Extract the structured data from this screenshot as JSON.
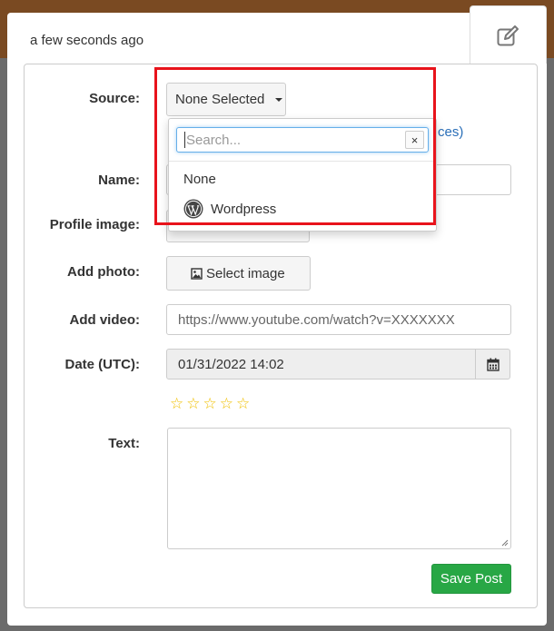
{
  "modal": {
    "timestamp": "a few seconds ago",
    "edit_icon": "edit-icon"
  },
  "form": {
    "source": {
      "label": "Source:",
      "selected": "None Selected",
      "partial_link_text": "ces",
      "partial_paren": ")"
    },
    "name": {
      "label": "Name:"
    },
    "profile_image": {
      "label": "Profile image:"
    },
    "add_photo": {
      "label": "Add photo:",
      "button": "Select image",
      "icon": "image-icon"
    },
    "add_video": {
      "label": "Add video:",
      "value": "https://www.youtube.com/watch?v=XXXXXXX"
    },
    "date": {
      "label": "Date (UTC):",
      "value": "01/31/2022 14:02",
      "icon": "calendar-icon"
    },
    "rating": {
      "stars": 5,
      "filled": 0
    },
    "text": {
      "label": "Text:"
    },
    "save_button": "Save Post"
  },
  "dropdown": {
    "search_placeholder": "Search...",
    "clear": "×",
    "options": [
      {
        "label": "None",
        "icon": ""
      },
      {
        "label": "Wordpress",
        "icon": "wordpress-icon"
      }
    ]
  },
  "colors": {
    "highlight": "#e8131b",
    "save_button": "#28a745",
    "star": "#f0c000",
    "link": "#2a6fb8"
  }
}
